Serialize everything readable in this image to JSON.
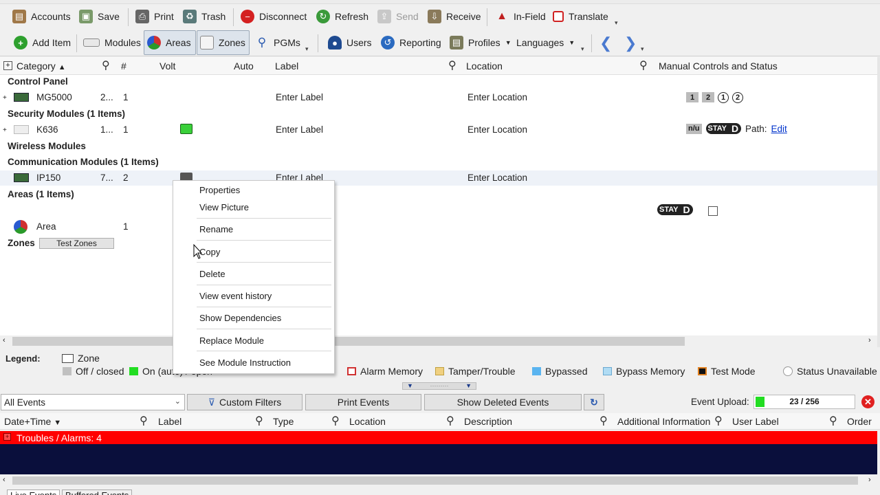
{
  "toolbar1": {
    "accounts": "Accounts",
    "save": "Save",
    "print": "Print",
    "trash": "Trash",
    "disconnect": "Disconnect",
    "refresh": "Refresh",
    "send": "Send",
    "receive": "Receive",
    "infield": "In-Field",
    "translate": "Translate"
  },
  "toolbar2": {
    "add_item": "Add Item",
    "modules": "Modules",
    "areas": "Areas",
    "zones": "Zones",
    "pgms": "PGMs",
    "users": "Users",
    "reporting": "Reporting",
    "profiles": "Profiles",
    "languages": "Languages"
  },
  "grid_header": {
    "category": "Category",
    "num": "#",
    "volt": "Volt",
    "auto": "Auto",
    "label": "Label",
    "location": "Location",
    "manual": "Manual Controls and Status"
  },
  "groups": {
    "control_panel": "Control Panel",
    "security_modules": "Security Modules (1 Items)",
    "wireless_modules": "Wireless Modules",
    "communication_modules": "Communication Modules (1 Items)",
    "areas": "Areas (1 Items)",
    "zones": "Zones",
    "test_zones": "Test Zones"
  },
  "rows": {
    "mg5000": {
      "name": "MG5000",
      "serial": "2...",
      "num": "1",
      "label": "Enter Label",
      "location": "Enter Location",
      "badges": [
        "1",
        "2",
        "1",
        "2"
      ]
    },
    "k636": {
      "name": "K636",
      "serial": "1...",
      "num": "1",
      "label": "Enter Label",
      "location": "Enter Location",
      "nu": "n/u",
      "stay": "STAY",
      "d": "D",
      "path_label": "Path:",
      "edit": "Edit"
    },
    "ip150": {
      "name": "IP150",
      "serial": "7...",
      "num": "2",
      "label": "Enter Label",
      "location": "Enter Location"
    },
    "area": {
      "name": "Area",
      "num": "1",
      "stay": "STAY",
      "d": "D"
    }
  },
  "context_menu": {
    "items": [
      "Properties",
      "View Picture",
      "Rename",
      "Copy",
      "Delete",
      "View event history",
      "Show Dependencies",
      "Replace Module",
      "See Module Instruction"
    ]
  },
  "legend": {
    "title": "Legend:",
    "zone": "Zone",
    "off_closed": "Off / closed",
    "on_auto": "On (auto) / open",
    "alarm_memory": "Alarm Memory",
    "tamper": "Tamper/Trouble",
    "bypassed": "Bypassed",
    "bypass_memory": "Bypass Memory",
    "test_mode": "Test Mode",
    "status_unavailable": "Status Unavailable"
  },
  "events_bar": {
    "filter_value": "All Events",
    "custom_filters": "Custom Filters",
    "print_events": "Print Events",
    "show_deleted": "Show Deleted Events",
    "upload_label": "Event Upload:",
    "upload_count": "23 / 256",
    "upload_progress": 0.09
  },
  "events_header": {
    "datetime": "Date+Time",
    "label": "Label",
    "type": "Type",
    "location": "Location",
    "description": "Description",
    "additional": "Additional Information",
    "user_label": "User Label",
    "order": "Order"
  },
  "troubles": "Troubles / Alarms: 4",
  "bottom_tabs": [
    "Live Events",
    "Buffered Events"
  ],
  "colors": {
    "trouble_red": "#ff0000",
    "events_bg": "#0a0f3c",
    "on_green": "#22dd22",
    "link_blue": "#0033cc"
  }
}
